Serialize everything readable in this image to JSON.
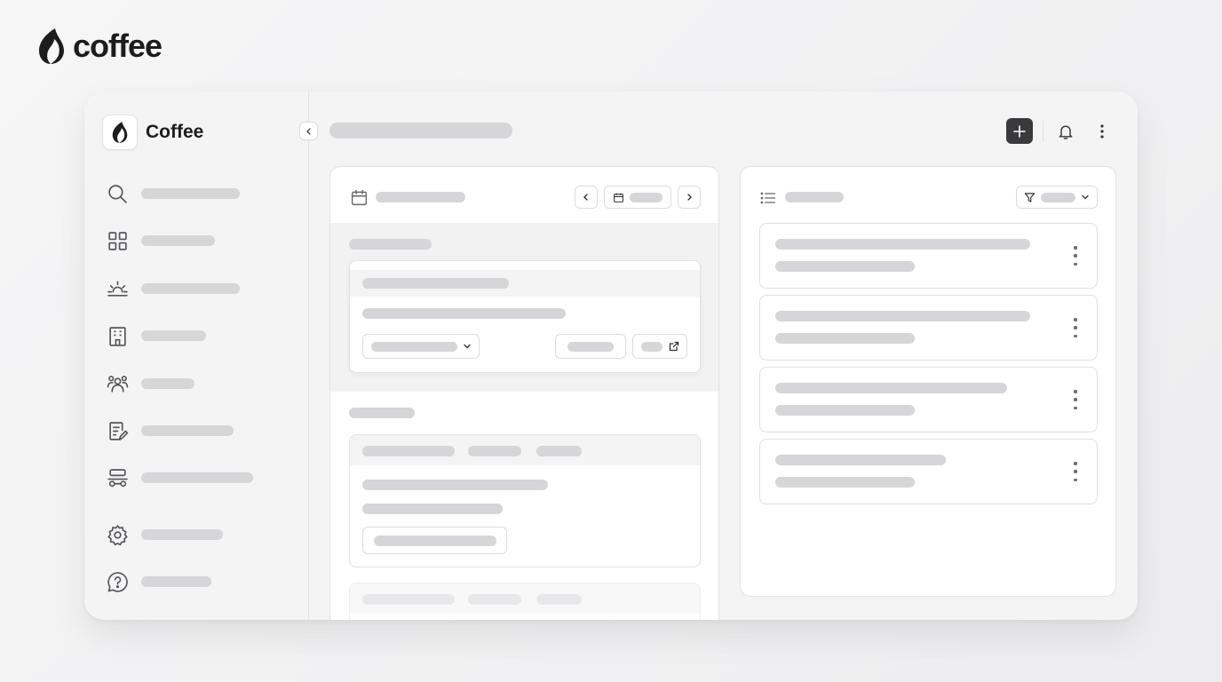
{
  "brand": {
    "wordmark": "coffee",
    "logo_icon": "flame-icon"
  },
  "app": {
    "name": "Coffee",
    "logo_icon": "flame-icon"
  },
  "sidebar": {
    "collapse_icon": "chevron-left-icon",
    "items": [
      {
        "icon": "search-icon",
        "label": ""
      },
      {
        "icon": "grid-icon",
        "label": ""
      },
      {
        "icon": "sunrise-icon",
        "label": ""
      },
      {
        "icon": "building-icon",
        "label": ""
      },
      {
        "icon": "users-icon",
        "label": ""
      },
      {
        "icon": "document-edit-icon",
        "label": ""
      },
      {
        "icon": "people-table-icon",
        "label": ""
      },
      {
        "icon": "gear-icon",
        "label": ""
      },
      {
        "icon": "help-circle-icon",
        "label": ""
      }
    ]
  },
  "topbar": {
    "title": "",
    "add_icon": "plus-icon",
    "notification_icon": "bell-icon",
    "menu_icon": "kebab-icon"
  },
  "calendar_panel": {
    "header_icon": "calendar-icon",
    "title": "",
    "prev_icon": "chevron-left-icon",
    "next_icon": "chevron-right-icon",
    "date_icon": "calendar-icon"
  },
  "list_panel": {
    "header_icon": "list-icon",
    "title": "",
    "filter_icon": "filter-icon",
    "item_count": 4
  },
  "colors": {
    "placeholder": "#d6d6d9",
    "accent_dark": "#3a3a3c",
    "surface": "#ffffff",
    "window_bg": "#f4f4f5"
  }
}
